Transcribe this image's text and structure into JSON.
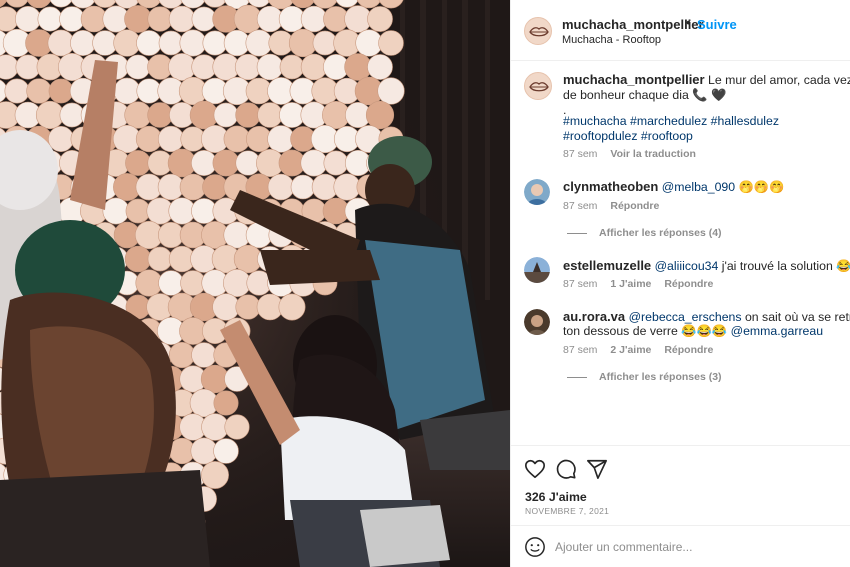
{
  "post": {
    "username": "muchacha_montpellier",
    "follow_label": "Suivre",
    "separator": "•",
    "location": "Muchacha - Rooftop",
    "caption": {
      "line1": "Le mur del amor, cada vez más r",
      "line2": "de bonheur chaque dia 📞 🖤",
      "line3": ".",
      "hashtags": "#muchacha #marchedulez #hallesdulez #rooftopdulez #rooftoop",
      "age": "87 sem",
      "translate_label": "Voir la traduction"
    }
  },
  "comments": [
    {
      "username": "clynmatheoben",
      "mention": "@melba_090",
      "text": " 🤭🤭🤭",
      "age": "87 sem",
      "likes": "",
      "reply_label": "Répondre",
      "view_replies": "Afficher les réponses (4)"
    },
    {
      "username": "estellemuzelle",
      "mention": "@aliiicou34",
      "text": " j'ai trouvé la solution 😂😜",
      "age": "87 sem",
      "likes": "1 J'aime",
      "reply_label": "Répondre",
      "view_replies": ""
    },
    {
      "username": "au.rora.va",
      "mention": "@rebecca_erschens",
      "text": " on sait où va se retrouver",
      "line2_text": "ton dessous de verre 😂😂😂 ",
      "line2_mention": "@emma.garreau",
      "age": "87 sem",
      "likes": "2 J'aime",
      "reply_label": "Répondre",
      "view_replies": "Afficher les réponses (3)"
    }
  ],
  "actions": {
    "icons": [
      "heart-icon",
      "comment-icon",
      "share-icon"
    ],
    "likes_count": "326 J'aime",
    "date": "NOVEMBRE 7, 2021"
  },
  "add_comment": {
    "placeholder": "Ajouter un commentaire...",
    "icon": "emoji-icon"
  },
  "colors": {
    "link_blue": "#0095f6",
    "mention_blue": "#00376b",
    "secondary_text": "#8e8e8e",
    "border": "#efefef"
  }
}
